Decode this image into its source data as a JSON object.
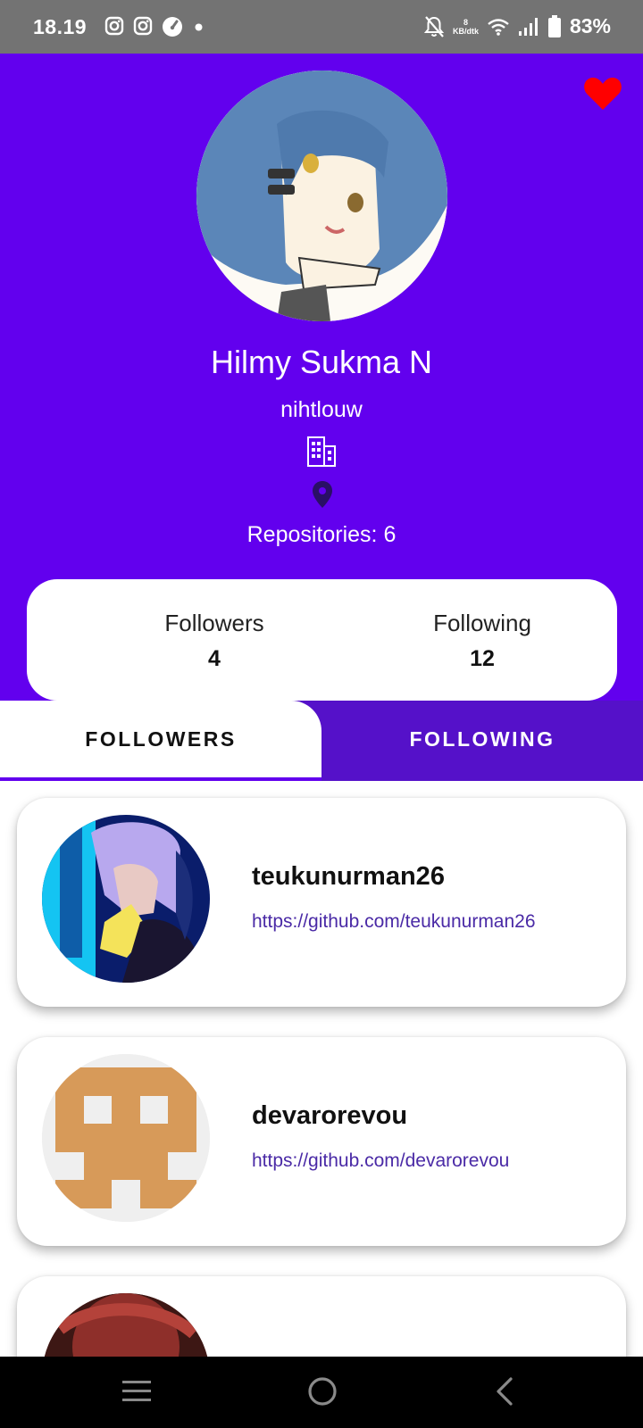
{
  "status_bar": {
    "time": "18.19",
    "net_speed_value": "8",
    "net_speed_unit": "KB/dtk",
    "battery": "83%",
    "icons": [
      "instagram-icon",
      "instagram-icon",
      "speedometer-icon",
      "dot-icon",
      "bell-off-icon",
      "wifi-icon",
      "signal-icon",
      "battery-icon"
    ]
  },
  "profile": {
    "name": "Hilmy Sukma N",
    "username": "nihtlouw",
    "repositories_label": "Repositories:",
    "repositories_count": "6",
    "icons": [
      "heart-icon",
      "company-icon",
      "location-icon"
    ]
  },
  "stats": {
    "followers_label": "Followers",
    "followers_value": "4",
    "following_label": "Following",
    "following_value": "12"
  },
  "tabs": [
    {
      "label": "FOLLOWERS",
      "selected": true
    },
    {
      "label": "FOLLOWING",
      "selected": false
    }
  ],
  "users": [
    {
      "login": "teukunurman26",
      "url": "https://github.com/teukunurman26"
    },
    {
      "login": "devarorevou",
      "url": "https://github.com/devarorevou"
    }
  ],
  "nav_bar": {
    "icons": [
      "menu-icon",
      "home-icon",
      "back-icon"
    ]
  },
  "colors": {
    "primary": "#6200ee",
    "tab_bar": "#5511c9",
    "heart": "#ff0000",
    "link": "#4a2aa6",
    "status_bar": "#737373"
  }
}
